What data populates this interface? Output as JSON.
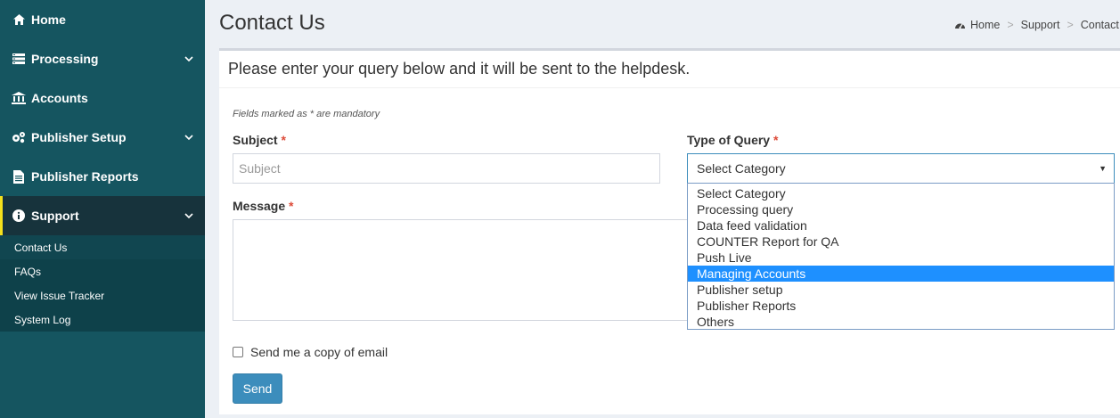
{
  "sidebar": {
    "items": [
      {
        "label": "Home",
        "icon": "home-icon",
        "has_children": false
      },
      {
        "label": "Processing",
        "icon": "list-icon",
        "has_children": true
      },
      {
        "label": "Accounts",
        "icon": "bank-icon",
        "has_children": false
      },
      {
        "label": "Publisher Setup",
        "icon": "gears-icon",
        "has_children": true
      },
      {
        "label": "Publisher Reports",
        "icon": "file-text-icon",
        "has_children": false
      },
      {
        "label": "Support",
        "icon": "info-circle-icon",
        "has_children": true,
        "active": true
      }
    ],
    "support_submenu": [
      {
        "label": "Contact Us",
        "current": true
      },
      {
        "label": "FAQs"
      },
      {
        "label": "View Issue Tracker"
      },
      {
        "label": "System Log"
      }
    ]
  },
  "header": {
    "title": "Contact Us",
    "breadcrumb": [
      "Home",
      "Support",
      "Contact Us"
    ]
  },
  "form": {
    "intro": "Please enter your query below and it will be sent to the helpdesk.",
    "mandatory_note": "Fields marked as * are mandatory",
    "required_marker": "*",
    "subject_label": "Subject",
    "subject_placeholder": "Subject",
    "subject_value": "",
    "query_type_label": "Type of Query",
    "query_type_value": "Select Category",
    "query_type_options": [
      "Select Category",
      "Processing query",
      "Data feed validation",
      "COUNTER Report for QA",
      "Push Live",
      "Managing Accounts",
      "Publisher setup",
      "Publisher Reports",
      "Others"
    ],
    "highlighted_option": "Managing Accounts",
    "message_label": "Message",
    "message_value": "",
    "copy_label": "Send me a copy of email",
    "copy_checked": false,
    "send_label": "Send"
  },
  "colors": {
    "sidebar_bg": "#155560",
    "active_border": "#f4e01c",
    "primary": "#3c8dbc",
    "highlight": "#1e90ff",
    "required": "#dd4b39"
  }
}
